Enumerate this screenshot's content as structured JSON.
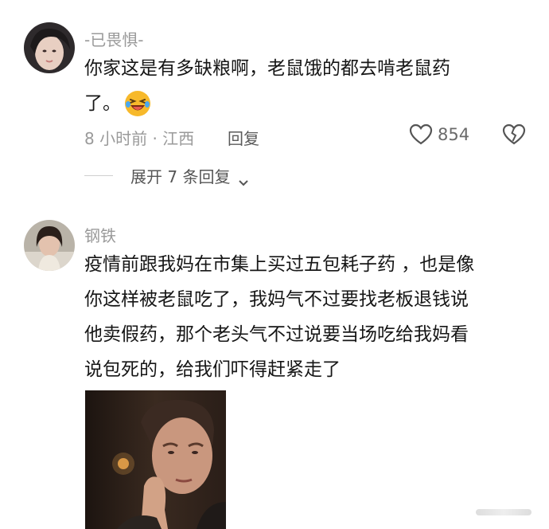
{
  "comments": [
    {
      "username": "-已畏惧-",
      "text_line1": "你家这是有多缺粮啊，老鼠饿的都去啃老鼠药",
      "text_line2": "了。",
      "emoji": "laughing-crying-emoji",
      "time_location": "8 小时前 · 江西",
      "reply_label": "回复",
      "likes": "854",
      "expand_label": "展开 7 条回复"
    },
    {
      "username": "钢铁",
      "lines": [
        "疫情前跟我妈在市集上买过五包耗子药 ，也是像",
        "你这样被老鼠吃了，我妈气不过要找老板退钱说",
        "他卖假药，那个老头气不过说要当场吃给我妈看",
        "说包死的，给我们吓得赶紧走了"
      ]
    }
  ],
  "colors": {
    "muted": "#9a9a9a",
    "text": "#161616",
    "emoji_yellow": "#f7b92b"
  }
}
